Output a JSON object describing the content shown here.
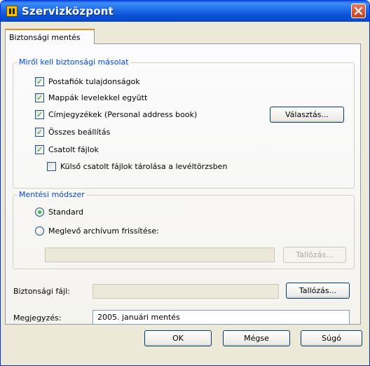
{
  "window": {
    "title": "Szervizközpont"
  },
  "tab": {
    "label": "Biztonsági mentés"
  },
  "backup_items": {
    "legend": "Miről kell biztonsági másolat",
    "items": [
      {
        "label": "Postafiók tulajdonságok",
        "checked": true
      },
      {
        "label": "Mappák levelekkel együtt",
        "checked": true
      },
      {
        "label": "Címjegyzékek (Personal address book)",
        "checked": true
      },
      {
        "label": "Összes beállítás",
        "checked": true
      },
      {
        "label": "Csatolt fájlok",
        "checked": true
      },
      {
        "label": "Külső csatolt fájlok tárolása a levéltörzsben",
        "checked": false
      }
    ],
    "select_button": "Választás..."
  },
  "save_method": {
    "legend": "Mentési módszer",
    "options": [
      {
        "label": "Standard",
        "selected": true
      },
      {
        "label": "Meglevő archívum frissítése:",
        "selected": false
      }
    ],
    "archive_path": "",
    "browse_button": "Tallózás..."
  },
  "backup_file": {
    "label": "Biztonsági fájl:",
    "value": "",
    "browse_button": "Tallózás..."
  },
  "note": {
    "label": "Megjegyzés:",
    "value": "2005. januári mentés"
  },
  "buttons": {
    "ok": "OK",
    "cancel": "Mégse",
    "help": "Súgó"
  },
  "colors": {
    "titlebar": "#0b52d8",
    "group_label": "#0046d5",
    "dialog_bg": "#ece9d8",
    "tab_highlight": "#e68b2c"
  }
}
